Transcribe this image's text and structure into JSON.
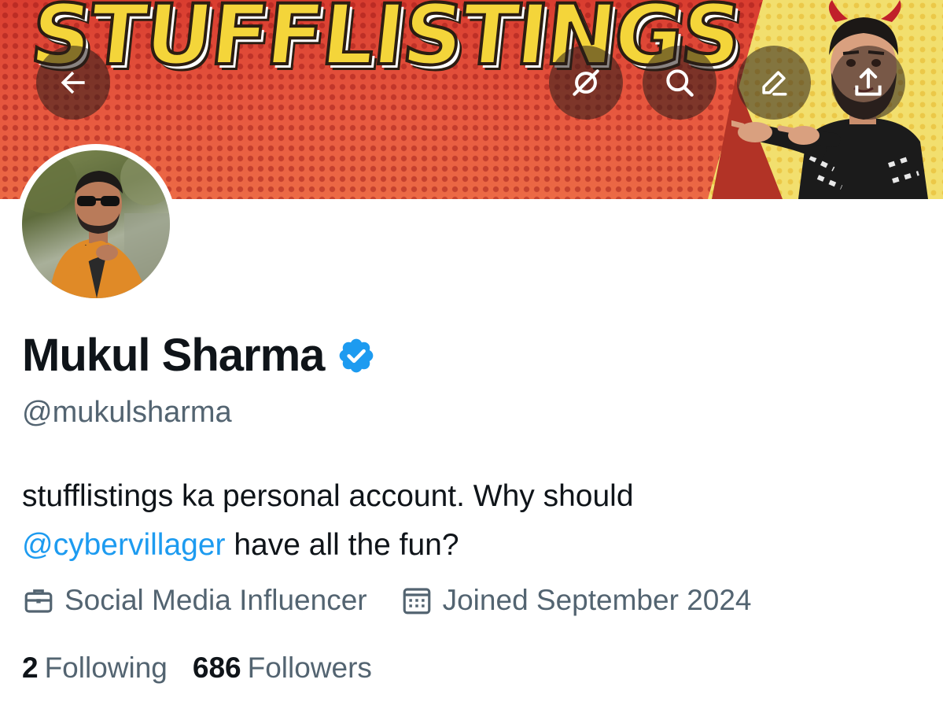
{
  "banner": {
    "logo_text": "STUFFLISTINGS",
    "colors": {
      "red": "#e24a3b",
      "yellow": "#f2df6e",
      "logo": "#f4d53a"
    }
  },
  "header_buttons": [
    {
      "icon": "back-arrow-icon"
    },
    {
      "icon": "grok-icon"
    },
    {
      "icon": "search-icon"
    },
    {
      "icon": "edit-icon"
    },
    {
      "icon": "share-icon"
    }
  ],
  "profile": {
    "name": "Mukul Sharma",
    "verified": true,
    "handle": "@mukulsharma",
    "bio_before": "stufflistings ka personal account. Why should",
    "bio_mention": "@cybervillager",
    "bio_after": " have all the fun?",
    "profession_icon": "briefcase-icon",
    "profession": "Social Media Influencer",
    "joined_icon": "calendar-icon",
    "joined": "Joined September 2024",
    "following_count": "2",
    "following_label": "Following",
    "followers_count": "686",
    "followers_label": "Followers"
  },
  "colors": {
    "accent": "#1d9bf0",
    "primary_text": "#0f1419",
    "secondary_text": "#536471"
  }
}
